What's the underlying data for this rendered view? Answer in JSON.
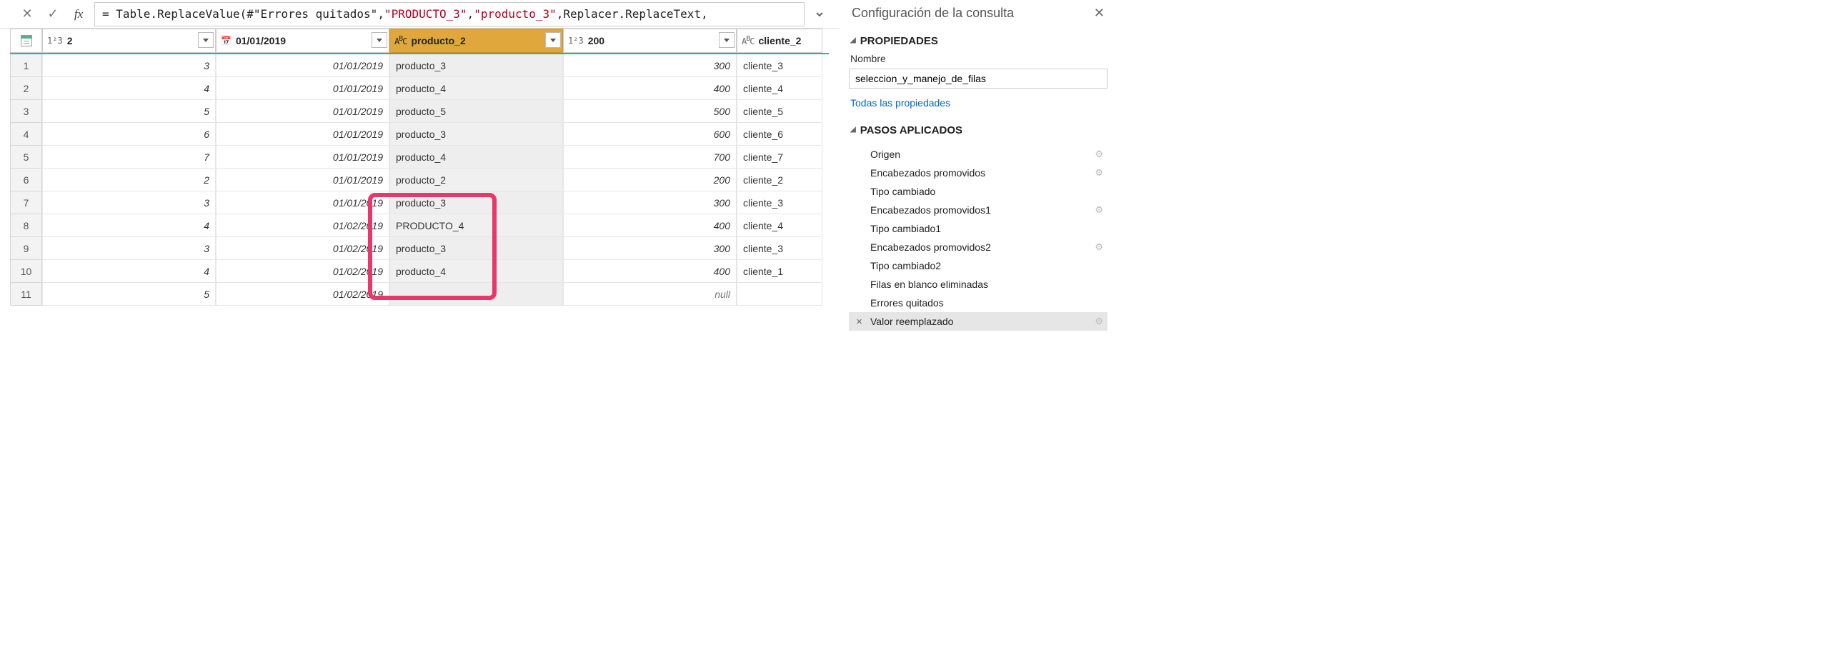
{
  "formula": {
    "p1": "= Table.ReplaceValue(#\"Errores quitados\",",
    "p2": "\"PRODUCTO_3\"",
    "p3": ",",
    "p4": "\"producto_3\"",
    "p5": ",Replacer.ReplaceText,"
  },
  "columns": {
    "c1": {
      "type": "1²3",
      "label": "2"
    },
    "c2": {
      "type": "date",
      "label": "01/01/2019"
    },
    "c3": {
      "type": "ABC",
      "label": "producto_2"
    },
    "c4": {
      "type": "1²3",
      "label": "200"
    },
    "c5": {
      "type": "ABC",
      "label": "cliente_2"
    }
  },
  "rows": [
    {
      "n": "1",
      "c1": "3",
      "c2": "01/01/2019",
      "c3": "producto_3",
      "c4": "300",
      "c5": "cliente_3"
    },
    {
      "n": "2",
      "c1": "4",
      "c2": "01/01/2019",
      "c3": "producto_4",
      "c4": "400",
      "c5": "cliente_4"
    },
    {
      "n": "3",
      "c1": "5",
      "c2": "01/01/2019",
      "c3": "producto_5",
      "c4": "500",
      "c5": "cliente_5"
    },
    {
      "n": "4",
      "c1": "6",
      "c2": "01/01/2019",
      "c3": "producto_3",
      "c4": "600",
      "c5": "cliente_6"
    },
    {
      "n": "5",
      "c1": "7",
      "c2": "01/01/2019",
      "c3": "producto_4",
      "c4": "700",
      "c5": "cliente_7"
    },
    {
      "n": "6",
      "c1": "2",
      "c2": "01/01/2019",
      "c3": "producto_2",
      "c4": "200",
      "c5": "cliente_2"
    },
    {
      "n": "7",
      "c1": "3",
      "c2": "01/01/2019",
      "c3": "producto_3",
      "c4": "300",
      "c5": "cliente_3"
    },
    {
      "n": "8",
      "c1": "4",
      "c2": "01/02/2019",
      "c3": "PRODUCTO_4",
      "c4": "400",
      "c5": "cliente_4"
    },
    {
      "n": "9",
      "c1": "3",
      "c2": "01/02/2019",
      "c3": "producto_3",
      "c4": "300",
      "c5": "cliente_3"
    },
    {
      "n": "10",
      "c1": "4",
      "c2": "01/02/2019",
      "c3": "producto_4",
      "c4": "400",
      "c5": "cliente_1"
    },
    {
      "n": "11",
      "c1": "5",
      "c2": "01/02/2019",
      "c3": "",
      "c4": "null",
      "c5": ""
    }
  ],
  "panel": {
    "title": "Configuración de la consulta",
    "propsHead": "PROPIEDADES",
    "nameLabel": "Nombre",
    "nameValue": "seleccion_y_manejo_de_filas",
    "allProps": "Todas las propiedades",
    "stepsHead": "PASOS APLICADOS",
    "steps": [
      {
        "label": "Origen",
        "gear": true
      },
      {
        "label": "Encabezados promovidos",
        "gear": true
      },
      {
        "label": "Tipo cambiado",
        "gear": false
      },
      {
        "label": "Encabezados promovidos1",
        "gear": true
      },
      {
        "label": "Tipo cambiado1",
        "gear": false
      },
      {
        "label": "Encabezados promovidos2",
        "gear": true
      },
      {
        "label": "Tipo cambiado2",
        "gear": false
      },
      {
        "label": "Filas en blanco eliminadas",
        "gear": false
      },
      {
        "label": "Errores quitados",
        "gear": false
      },
      {
        "label": "Valor reemplazado",
        "gear": true,
        "active": true
      }
    ]
  }
}
